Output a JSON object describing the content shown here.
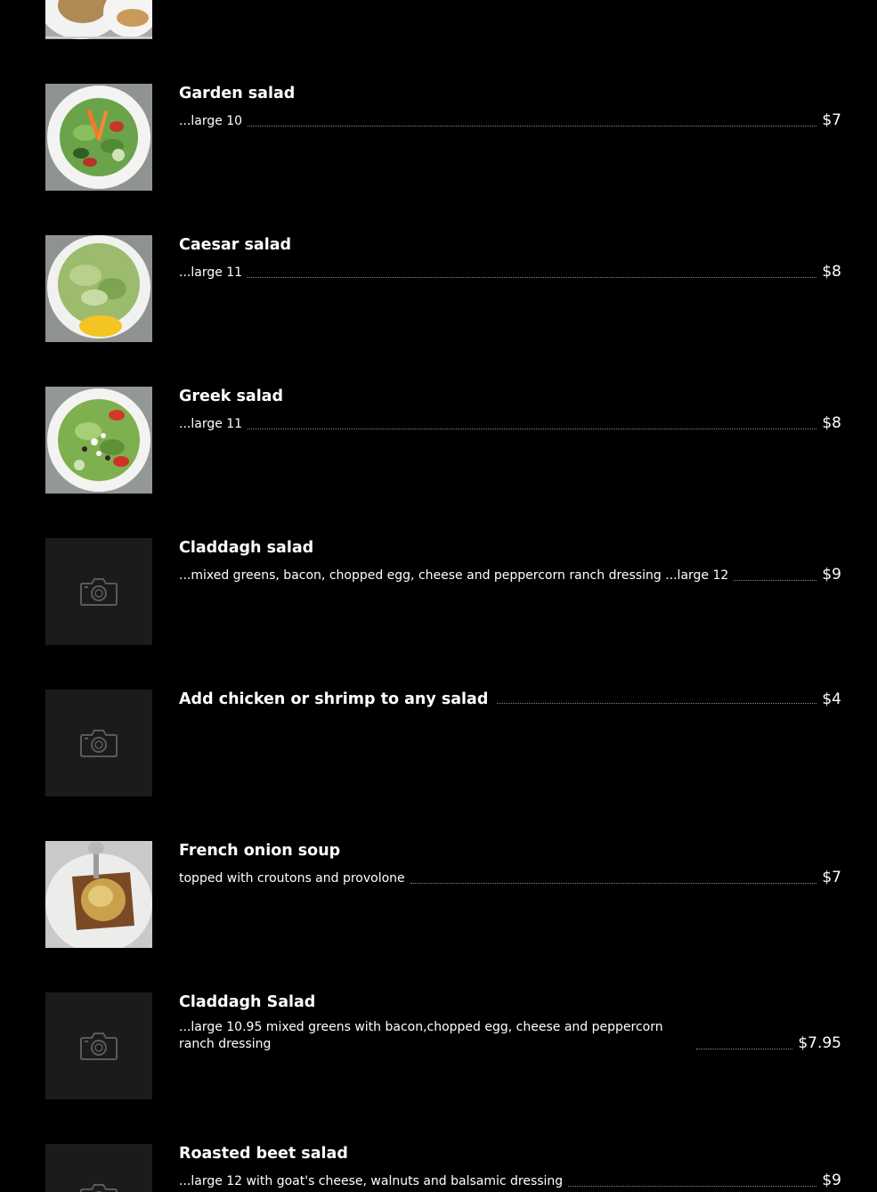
{
  "colors": {
    "background": "#000000",
    "text": "#ffffff",
    "placeholder_tile": "#1b1b1b",
    "dot_leader": "#8a8a8a"
  },
  "items": [
    {
      "name": "",
      "description": "",
      "price": "",
      "image": "soup-and-bread-photo"
    },
    {
      "name": "Garden salad",
      "description": "...large 10",
      "price": "$7",
      "image": "garden-salad-photo"
    },
    {
      "name": "Caesar salad",
      "description": "...large 11",
      "price": "$8",
      "image": "caesar-salad-photo"
    },
    {
      "name": "Greek salad",
      "description": "...large 11",
      "price": "$8",
      "image": "greek-salad-photo"
    },
    {
      "name": "Claddagh salad",
      "description": "...mixed greens, bacon, chopped egg, cheese and peppercorn ranch dressing ...large 12",
      "price": "$9",
      "image": "camera-icon"
    },
    {
      "name": "Add chicken or shrimp to any salad",
      "description": "",
      "price": "$4",
      "image": "camera-icon"
    },
    {
      "name": "French onion soup",
      "description": "topped with croutons and provolone",
      "price": "$7",
      "image": "french-onion-soup-photo"
    },
    {
      "name": "Claddagh Salad",
      "description": "...large 10.95 mixed greens with bacon,chopped egg, cheese and peppercorn ranch dressing",
      "price": "$7.95",
      "image": "camera-icon"
    },
    {
      "name": "Roasted beet salad",
      "description": "...large 12 with goat's cheese, walnuts and balsamic dressing",
      "price": "$9",
      "image": "camera-icon"
    }
  ]
}
